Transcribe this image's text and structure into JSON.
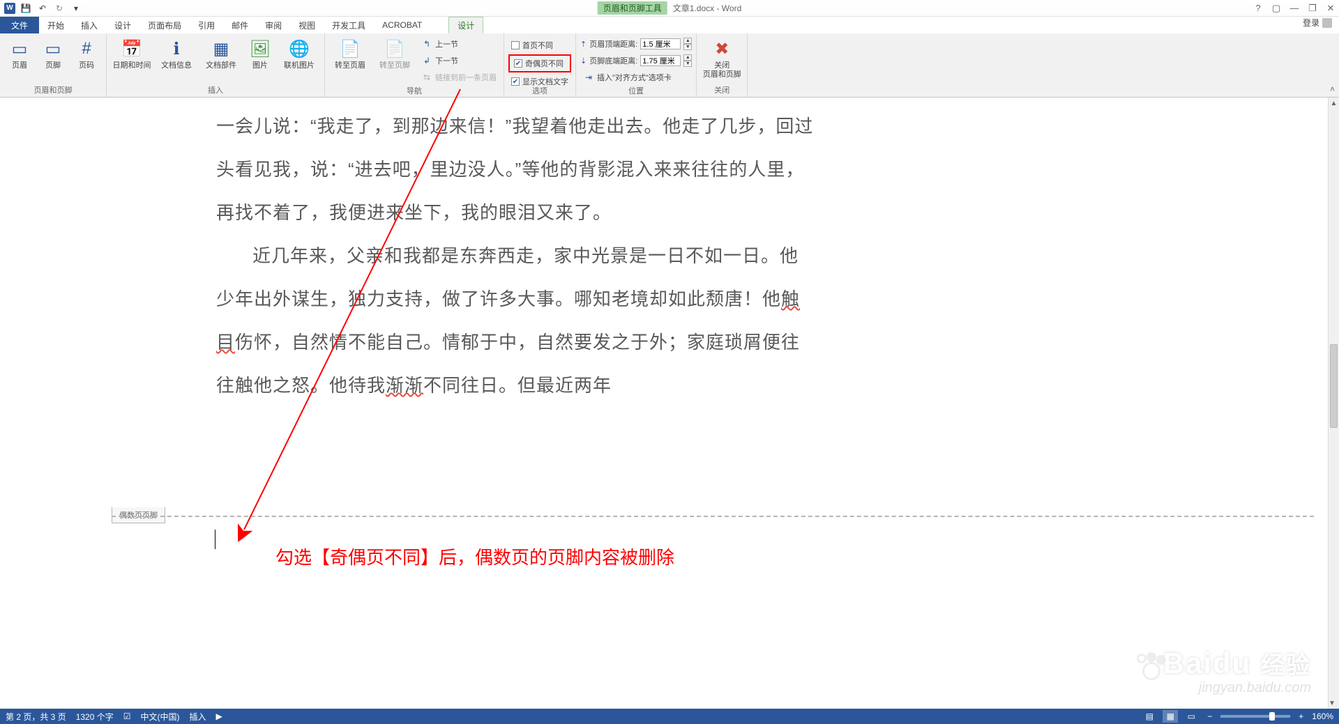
{
  "titlebar": {
    "contextual_label": "页眉和页脚工具",
    "doc_title": "文章1.docx - Word",
    "login": "登录"
  },
  "qat": {
    "save": "💾",
    "undo": "↶",
    "redo": "↻"
  },
  "tabs": {
    "file": "文件",
    "home": "开始",
    "insert": "插入",
    "design": "设计",
    "layout": "页面布局",
    "references": "引用",
    "mailings": "邮件",
    "review": "审阅",
    "view": "视图",
    "developer": "开发工具",
    "acrobat": "ACROBAT",
    "hf_design": "设计"
  },
  "ribbon": {
    "g_hf": {
      "label": "页眉和页脚",
      "header": "页眉",
      "footer": "页脚",
      "pagenum": "页码"
    },
    "g_insert": {
      "label": "插入",
      "datetime": "日期和时间",
      "docinfo": "文档信息",
      "docparts": "文档部件",
      "picture": "图片",
      "onlinepic": "联机图片"
    },
    "g_nav": {
      "label": "导航",
      "goto_header": "转至页眉",
      "goto_footer": "转至页脚",
      "prev": "上一节",
      "next": "下一节",
      "link_prev": "链接到前一条页眉"
    },
    "g_options": {
      "label": "选项",
      "diff_first": "首页不同",
      "diff_oddeven": "奇偶页不同",
      "show_doc": "显示文档文字"
    },
    "g_position": {
      "label": "位置",
      "header_dist": "页眉顶端距离:",
      "footer_dist": "页脚底端距离:",
      "header_val": "1.5 厘米",
      "footer_val": "1.75 厘米",
      "align_tab": "插入\"对齐方式\"选项卡"
    },
    "g_close": {
      "label": "关闭",
      "close_hf_l1": "关闭",
      "close_hf_l2": "页眉和页脚"
    }
  },
  "document": {
    "para1": "一会儿说：“我走了，到那边来信！”我望着他走出去。他走了几步，回过头看见我，说：“进去吧，里边没人。”等他的背影混入来来往往的人里，再找不着了，我便进来坐下，我的眼泪又来了。",
    "para2_a": "近几年来，父亲和我都是东奔西走，家中光景是一日不如一日。他少年出外谋生，独力支持，做了许多大事。哪知老境却如此颓唐！他",
    "para2_b": "触目",
    "para2_c": "伤怀，自然情不能自己。情郁于中，自然要发之于外；家庭琐屑便往往触他之怒。他待我",
    "para2_d": "渐渐",
    "para2_e": "不同往日。但最近两年",
    "footer_tag": "偶数页页脚",
    "annotation": "勾选【奇偶页不同】后，偶数页的页脚内容被删除"
  },
  "statusbar": {
    "page": "第 2 页，共 3 页",
    "words": "1320 个字",
    "lang": "中文(中国)",
    "mode": "插入",
    "zoom": "160%"
  },
  "watermark": {
    "logo1": "Bai",
    "logo2": "du",
    "logo3": "经验",
    "url": "jingyan.baidu.com"
  }
}
